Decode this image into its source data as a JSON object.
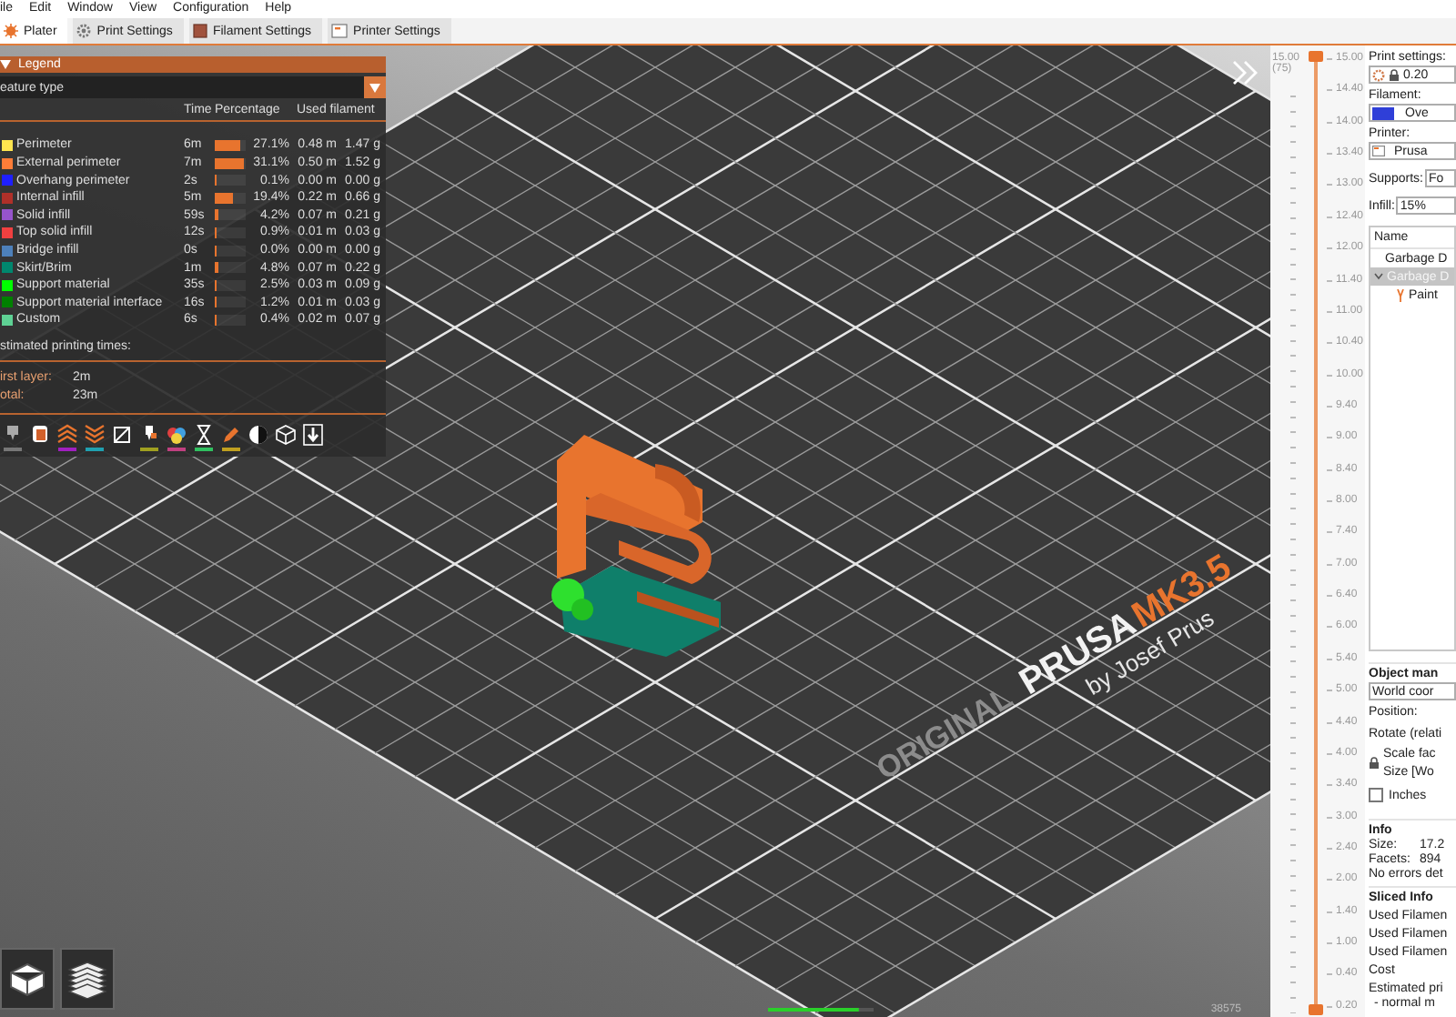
{
  "menu": [
    "ile",
    "Edit",
    "Window",
    "View",
    "Configuration",
    "Help"
  ],
  "tabs": [
    {
      "label": "Plater",
      "selected": true
    },
    {
      "label": "Print Settings",
      "selected": false
    },
    {
      "label": "Filament Settings",
      "selected": false
    },
    {
      "label": "Printer Settings",
      "selected": false
    }
  ],
  "legend": {
    "title": "Legend",
    "view_type": "eature type",
    "columns": [
      "Time",
      "Percentage",
      "Used filament"
    ],
    "items": [
      {
        "name": "Perimeter",
        "color": "#ffe54f",
        "time": "6m",
        "level": 0.82,
        "percentage": "27.1%",
        "length": "0.48 m",
        "weight": "1.47 g"
      },
      {
        "name": "External perimeter",
        "color": "#ff7d38",
        "time": "7m",
        "level": 0.94,
        "percentage": "31.1%",
        "length": "0.50 m",
        "weight": "1.52 g"
      },
      {
        "name": "Overhang perimeter",
        "color": "#1f1fff",
        "time": "2s",
        "level": 0.003,
        "percentage": "0.1%",
        "length": "0.00 m",
        "weight": "0.00 g"
      },
      {
        "name": "Internal infill",
        "color": "#b03029",
        "time": "5m",
        "level": 0.59,
        "percentage": "19.4%",
        "length": "0.22 m",
        "weight": "0.66 g"
      },
      {
        "name": "Solid infill",
        "color": "#9654cc",
        "time": "59s",
        "level": 0.13,
        "percentage": "4.2%",
        "length": "0.07 m",
        "weight": "0.21 g"
      },
      {
        "name": "Top solid infill",
        "color": "#f04040",
        "time": "12s",
        "level": 0.03,
        "percentage": "0.9%",
        "length": "0.01 m",
        "weight": "0.03 g"
      },
      {
        "name": "Bridge infill",
        "color": "#4d80ba",
        "time": "0s",
        "level": 0,
        "percentage": "0.0%",
        "length": "0.00 m",
        "weight": "0.00 g"
      },
      {
        "name": "Skirt/Brim",
        "color": "#00876e",
        "time": "1m",
        "level": 0.145,
        "percentage": "4.8%",
        "length": "0.07 m",
        "weight": "0.22 g"
      },
      {
        "name": "Support material",
        "color": "#00ff00",
        "time": "35s",
        "level": 0.076,
        "percentage": "2.5%",
        "length": "0.03 m",
        "weight": "0.09 g"
      },
      {
        "name": "Support material interface",
        "color": "#008000",
        "time": "16s",
        "level": 0.036,
        "percentage": "1.2%",
        "length": "0.01 m",
        "weight": "0.03 g"
      },
      {
        "name": "Custom",
        "color": "#5ed194",
        "time": "6s",
        "level": 0.012,
        "percentage": "0.4%",
        "length": "0.02 m",
        "weight": "0.07 g"
      }
    ],
    "times_title": "stimated printing times:",
    "times": [
      {
        "label": "irst layer:",
        "value": "2m"
      },
      {
        "label": "otal:",
        "value": "23m"
      }
    ]
  },
  "bed_logo": {
    "line": "ORIGINAL",
    "brand": "PRUSA",
    "model": "MK3.5",
    "maker": "by Josef Prus"
  },
  "horizontal_slider": {
    "label": "38575",
    "level": 0.86
  },
  "layer_slider": {
    "top_value": "15.00",
    "top_layer": "(75)",
    "upper": {
      "level": 1
    },
    "lower": {
      "level": 0
    },
    "ticks": [
      "15.00",
      "14.40",
      "14.00",
      "13.40",
      "13.00",
      "12.40",
      "12.00",
      "11.40",
      "11.00",
      "10.40",
      "10.00",
      "9.40",
      "9.00",
      "8.40",
      "8.00",
      "7.40",
      "7.00",
      "6.40",
      "6.00",
      "5.40",
      "5.00",
      "4.40",
      "4.00",
      "3.40",
      "3.00",
      "2.40",
      "2.00",
      "1.40",
      "1.00",
      "0.40",
      "0.20"
    ]
  },
  "sidebar": {
    "print_settings": {
      "label": "Print settings:",
      "value": "0.20"
    },
    "filament": {
      "label": "Filament:",
      "value": "Ove"
    },
    "printer": {
      "label": "Printer:",
      "value": "Prusa"
    },
    "supports": {
      "label": "Supports:",
      "value": "Fo"
    },
    "infill": {
      "label": "Infill:",
      "value": "15%"
    },
    "object_list": {
      "header": "Name",
      "items": [
        {
          "name": "Garbage D",
          "selected": false
        },
        {
          "name": "Garbage D",
          "selected": true,
          "expanded": true,
          "children": [
            {
              "name": "Paint",
              "selected": false
            }
          ]
        }
      ]
    },
    "object_manipulation": {
      "title": "Object man",
      "coordinates": "World coor",
      "position": "Position:",
      "rotate": "Rotate (relati",
      "scale": "Scale fac",
      "size": "Size [Wo",
      "inches": {
        "label": "Inches",
        "checked": false
      }
    },
    "info": {
      "title": "Info",
      "rows": [
        {
          "label": "Size:",
          "value": "17.2"
        },
        {
          "label": "Facets:",
          "value": "894"
        }
      ],
      "status": "No errors det"
    },
    "sliced_info": {
      "title": "Sliced Info",
      "rows": [
        "Used Filamen",
        "Used Filamen",
        "Used Filamen",
        "Cost"
      ],
      "estimate": "Estimated pri",
      "estimate_mode": "- normal m"
    }
  }
}
